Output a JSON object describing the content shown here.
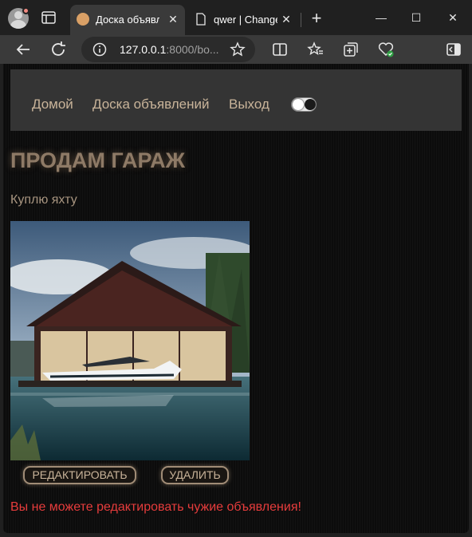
{
  "browser": {
    "tabs": [
      {
        "title": "Доска объявле",
        "active": true
      },
      {
        "title": "qwer | Change",
        "active": false
      }
    ],
    "address": {
      "host": "127.0.0.1",
      "path": ":8000/bo..."
    },
    "window_controls": {
      "minimize": "—",
      "maximize": "☐",
      "close": "✕"
    }
  },
  "nav": {
    "home": "Домой",
    "board": "Доска объявлений",
    "logout": "Выход"
  },
  "post": {
    "title": "ПРОДАМ ГАРАЖ",
    "text": "Куплю яхту",
    "image_alt": "boathouse-with-yacht"
  },
  "actions": {
    "edit_label": "РЕДАКТИРОВАТЬ",
    "delete_label": "УДАЛИТЬ"
  },
  "warning": "Вы не можете редактировать чужие объявления!",
  "colors": {
    "nav_text": "#c9b49a",
    "title": "#8e7a66",
    "warning": "#e63c3c",
    "navbar_bg": "#343434"
  }
}
